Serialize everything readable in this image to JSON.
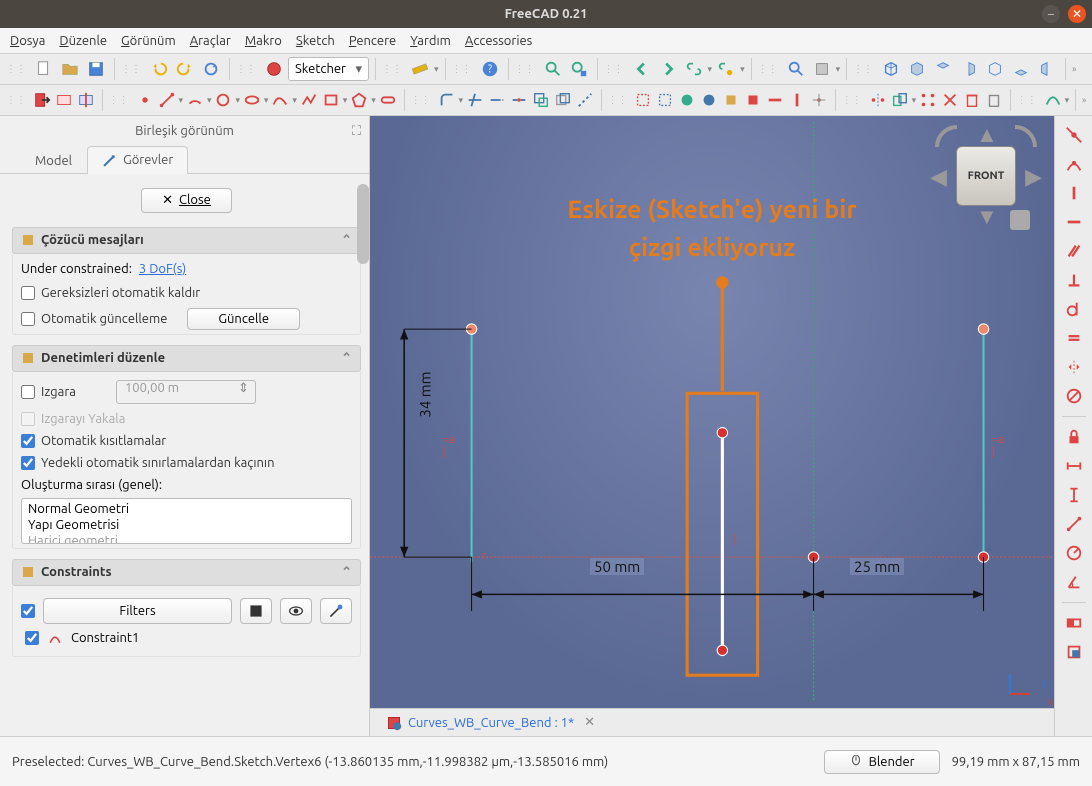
{
  "window": {
    "title": "FreeCAD 0.21"
  },
  "menu": [
    "Dosya",
    "Düzenle",
    "Görünüm",
    "Araçlar",
    "Makro",
    "Sketch",
    "Pencere",
    "Yardım",
    "Accessories"
  ],
  "workbench": "Sketcher",
  "panel": {
    "title": "Birleşik görünüm",
    "tab_model": "Model",
    "tab_tasks": "Görevler",
    "close": "Close"
  },
  "solver": {
    "title": "Çözücü mesajları",
    "under_constrained": "Under constrained:",
    "dof": "3 DoF(s)",
    "auto_remove": "Gereksizleri otomatik kaldır",
    "auto_update": "Otomatik güncelleme",
    "update_btn": "Güncelle"
  },
  "edit": {
    "title": "Denetimleri düzenle",
    "grid": "Izgara",
    "grid_val": "100,00 m",
    "snap": "Izgarayı Yakala",
    "auto_constraints": "Otomatik kısıtlamalar",
    "avoid_redundant": "Yedekli otomatik sınırlamalardan kaçının",
    "order_label": "Oluşturma sırası (genel):",
    "order_items": [
      "Normal Geometri",
      "Yapı Geometrisi",
      "Harici geometri"
    ]
  },
  "constraints": {
    "title": "Constraints",
    "filters": "Filters",
    "item1": "Constraint1"
  },
  "overlay": {
    "line1": "Eskize (Sketch'e) yeni bir",
    "line2": "çizgi ekliyoruz"
  },
  "dimensions": {
    "d34": "34 mm",
    "d50": "50 mm",
    "d25": "25 mm"
  },
  "nav_cube": "FRONT",
  "doc_tab": "Curves_WB_Curve_Bend : 1*",
  "status": {
    "message": "Preselected: Curves_WB_Curve_Bend.Sketch.Vertex6 (-13.860135 mm,-11.998382 µm,-13.585016 mm)",
    "blender": "Blender",
    "coords": "99,19 mm x 87,15 mm"
  }
}
